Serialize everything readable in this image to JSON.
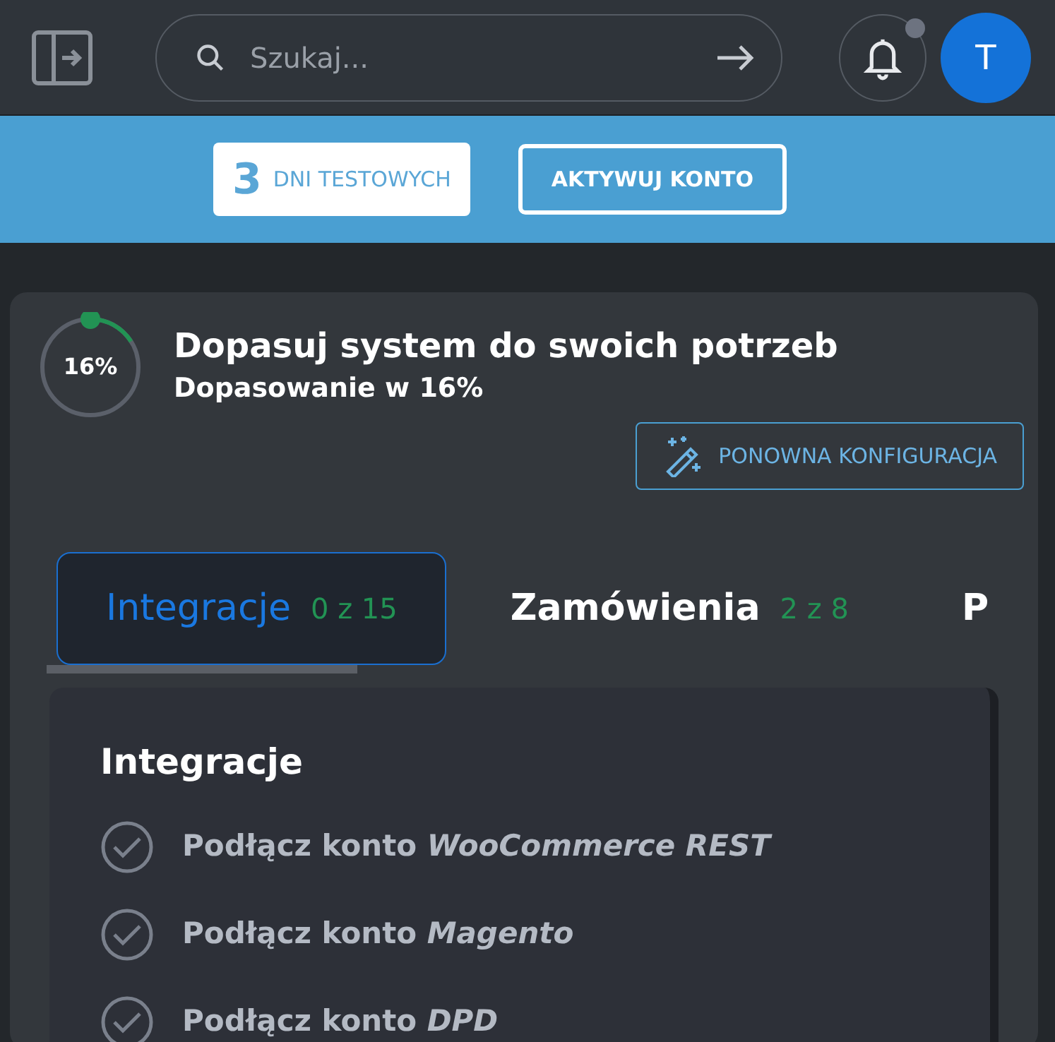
{
  "search": {
    "placeholder": "Szukaj..."
  },
  "avatar": {
    "initial": "T"
  },
  "trial": {
    "days": "3",
    "label": "DNI TESTOWYCH",
    "button": "AKTYWUJ KONTO"
  },
  "setup": {
    "title": "Dopasuj system do swoich potrzeb",
    "subtitle": "Dopasowanie w 16%",
    "progress_label": "16%",
    "level": 0.16,
    "reconfigure_button": "PONOWNA KONFIGURACJA"
  },
  "tabs": [
    {
      "label": "Integracje",
      "count": "0 z 15",
      "selected": true
    },
    {
      "label": "Zamówienia",
      "count": "2 z 8",
      "selected": false
    },
    {
      "label": "P",
      "selected": false
    }
  ],
  "section": {
    "title": "Integracje",
    "tasks": [
      {
        "text": "Podłącz konto *WooCommerce REST*",
        "done": false
      },
      {
        "text": "Podłącz konto *Magento*",
        "done": false
      },
      {
        "text": "Podłącz konto *DPD*",
        "done": false
      }
    ]
  }
}
